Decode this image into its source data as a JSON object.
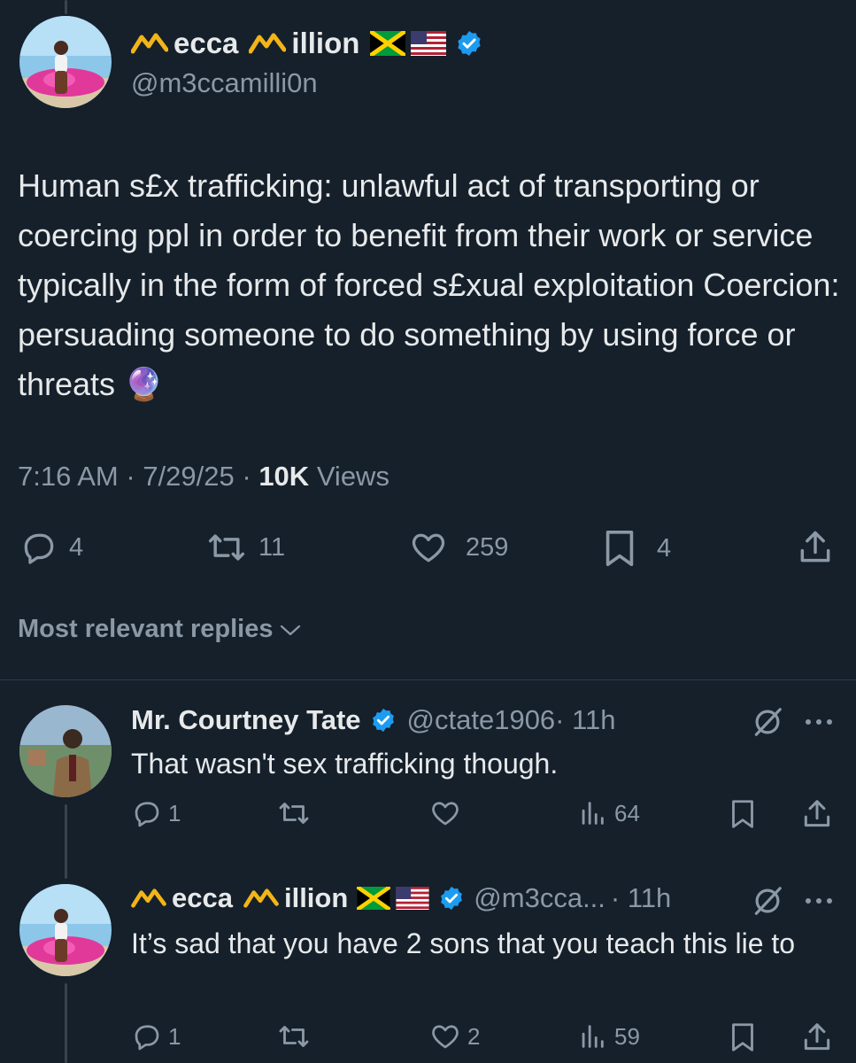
{
  "colors": {
    "background": "#15202b",
    "text": "#e7e9ea",
    "muted": "#8b98a5",
    "verified": "#1d9bf0",
    "logo_gold": "#f2b418"
  },
  "main_tweet": {
    "author_name": "ecca",
    "author_name2": "illion",
    "handle": "@m3ccamilli0n",
    "text": "Human s£x trafficking: unlawful act of transporting or coercing ppl in order to benefit from their work or service typically in the form of forced s£xual exploitation Coercion: persuading someone to do something by using force or threats 🔮",
    "time": "7:16 AM",
    "date": "7/29/25",
    "views_count": "10K",
    "views_label": "Views",
    "replies": "4",
    "retweets": "11",
    "likes": "259",
    "bookmarks": "4"
  },
  "sort": {
    "label": "Most relevant replies"
  },
  "replies": [
    {
      "name": "Mr. Courtney Tate",
      "handle": "@ctate1906",
      "time": "· 11h",
      "text": "That wasn't sex trafficking though.",
      "replies": "1",
      "retweets": "",
      "likes": "",
      "views": "64"
    },
    {
      "name1": "ecca",
      "name2": "illion",
      "handle": "@m3cca...",
      "time": "· 11h",
      "text": "It’s sad that you have 2 sons that you teach this lie to",
      "replies": "1",
      "retweets": "",
      "likes": "2",
      "views": "59"
    }
  ],
  "icons": [
    "m-logo-icon",
    "jamaica-flag-icon",
    "us-flag-icon",
    "verified-badge-icon",
    "reply-icon",
    "retweet-icon",
    "like-icon",
    "bookmark-icon",
    "share-icon",
    "chevron-down-icon",
    "views-icon",
    "grok-icon",
    "more-icon"
  ]
}
